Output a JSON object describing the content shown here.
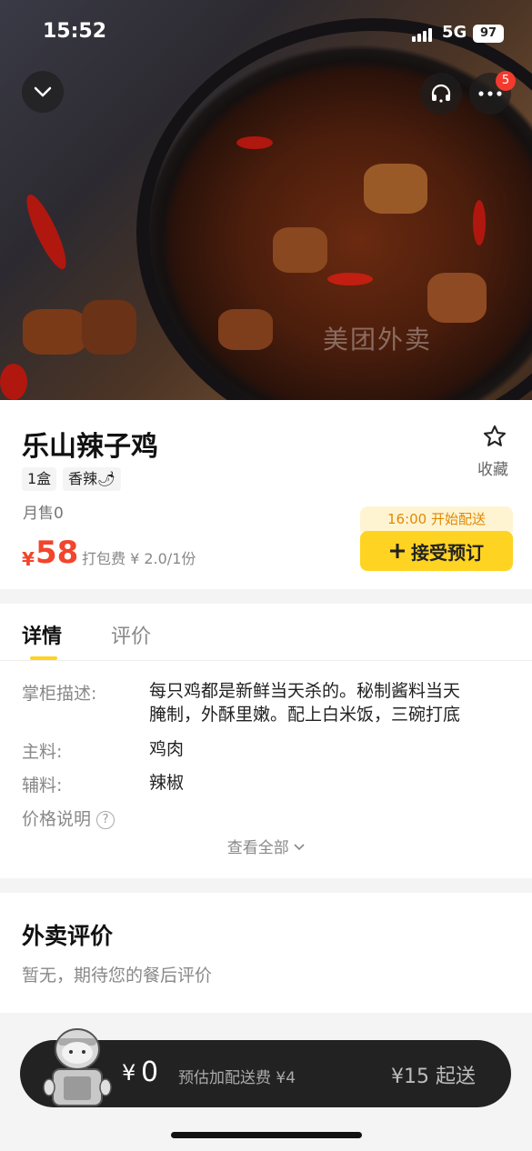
{
  "status_bar": {
    "time": "15:52",
    "network": "5G",
    "battery": "97"
  },
  "hero": {
    "watermark": "美团外卖",
    "menu_badge": "5"
  },
  "product": {
    "name": "乐山辣子鸡",
    "favorite_label": "收藏",
    "tags": [
      "1盒",
      "香辣🌶"
    ],
    "monthly_sales": "月售0",
    "price_symbol": "¥",
    "price": "58",
    "packing_fee": "打包费 ¥ 2.0/1份",
    "delivery_start": "16:00 开始配送",
    "preorder_label": "接受预订"
  },
  "tabs": {
    "details": "详情",
    "reviews": "评价"
  },
  "details": {
    "desc_label": "掌柜描述:",
    "desc_line1": "每只鸡都是新鲜当天杀的。秘制酱料当天",
    "desc_line2": "腌制，外酥里嫩。配上白米饭，三碗打底",
    "main_label": "主料:",
    "main_value": "鸡肉",
    "aux_label": "辅料:",
    "aux_value": "辣椒",
    "price_note_label": "价格说明",
    "price_note_icon": "?",
    "see_all": "查看全部"
  },
  "reviews": {
    "title": "外卖评价",
    "empty": "暂无，期待您的餐后评价"
  },
  "cart": {
    "symbol": "¥",
    "total": "0",
    "fee_note": "预估加配送费 ¥4",
    "min_order": "¥15 起送"
  },
  "colors": {
    "accent_yellow": "#ffd321",
    "price_red": "#f2452c"
  }
}
